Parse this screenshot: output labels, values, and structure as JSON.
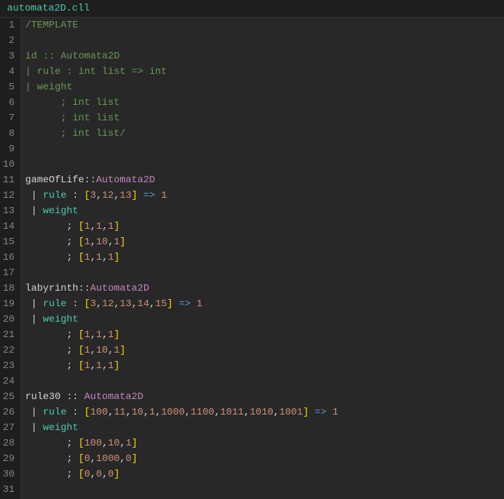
{
  "filename": "automata2D.cll",
  "code": {
    "lines": [
      {
        "n": 1,
        "tokens": [
          {
            "t": "/TEMPLATE",
            "c": "c-comment"
          }
        ]
      },
      {
        "n": 2,
        "tokens": []
      },
      {
        "n": 3,
        "tokens": [
          {
            "t": "id ",
            "c": "c-comment"
          },
          {
            "t": ":: ",
            "c": "c-comment"
          },
          {
            "t": "Automata2D",
            "c": "c-comment"
          }
        ]
      },
      {
        "n": 4,
        "tokens": [
          {
            "t": "| rule : int list => int",
            "c": "c-comment"
          }
        ]
      },
      {
        "n": 5,
        "tokens": [
          {
            "t": "| weight",
            "c": "c-comment"
          }
        ]
      },
      {
        "n": 6,
        "tokens": [
          {
            "t": "      ; int list",
            "c": "c-comment"
          }
        ]
      },
      {
        "n": 7,
        "tokens": [
          {
            "t": "      ; int list",
            "c": "c-comment"
          }
        ]
      },
      {
        "n": 8,
        "tokens": [
          {
            "t": "      ; int list/",
            "c": "c-comment"
          }
        ]
      },
      {
        "n": 9,
        "tokens": []
      },
      {
        "n": 10,
        "tokens": []
      },
      {
        "n": 11,
        "tokens": [
          {
            "t": "gameOfLife",
            "c": "c-ident"
          },
          {
            "t": "::",
            "c": "c-punct"
          },
          {
            "t": "Automata2D",
            "c": "c-type"
          }
        ]
      },
      {
        "n": 12,
        "tokens": [
          {
            "t": " ",
            "c": "c-white"
          },
          {
            "t": "|",
            "c": "c-punct"
          },
          {
            "t": " ",
            "c": "c-white"
          },
          {
            "t": "rule",
            "c": "c-key"
          },
          {
            "t": " : ",
            "c": "c-punct"
          },
          {
            "t": "[",
            "c": "c-brack"
          },
          {
            "t": "3",
            "c": "c-num"
          },
          {
            "t": ",",
            "c": "c-sep"
          },
          {
            "t": "12",
            "c": "c-num"
          },
          {
            "t": ",",
            "c": "c-sep"
          },
          {
            "t": "13",
            "c": "c-num"
          },
          {
            "t": "]",
            "c": "c-brack"
          },
          {
            "t": " ",
            "c": "c-white"
          },
          {
            "t": "=>",
            "c": "c-op"
          },
          {
            "t": " ",
            "c": "c-white"
          },
          {
            "t": "1",
            "c": "c-num"
          }
        ]
      },
      {
        "n": 13,
        "tokens": [
          {
            "t": " ",
            "c": "c-white"
          },
          {
            "t": "|",
            "c": "c-punct"
          },
          {
            "t": " ",
            "c": "c-white"
          },
          {
            "t": "weight",
            "c": "c-key"
          }
        ]
      },
      {
        "n": 14,
        "tokens": [
          {
            "t": "       ; ",
            "c": "c-punct"
          },
          {
            "t": "[",
            "c": "c-brack"
          },
          {
            "t": "1",
            "c": "c-num"
          },
          {
            "t": ",",
            "c": "c-sep"
          },
          {
            "t": "1",
            "c": "c-num"
          },
          {
            "t": ",",
            "c": "c-sep"
          },
          {
            "t": "1",
            "c": "c-num"
          },
          {
            "t": "]",
            "c": "c-brack"
          }
        ]
      },
      {
        "n": 15,
        "tokens": [
          {
            "t": "       ; ",
            "c": "c-punct"
          },
          {
            "t": "[",
            "c": "c-brack"
          },
          {
            "t": "1",
            "c": "c-num"
          },
          {
            "t": ",",
            "c": "c-sep"
          },
          {
            "t": "10",
            "c": "c-num"
          },
          {
            "t": ",",
            "c": "c-sep"
          },
          {
            "t": "1",
            "c": "c-num"
          },
          {
            "t": "]",
            "c": "c-brack"
          }
        ]
      },
      {
        "n": 16,
        "tokens": [
          {
            "t": "       ; ",
            "c": "c-punct"
          },
          {
            "t": "[",
            "c": "c-brack"
          },
          {
            "t": "1",
            "c": "c-num"
          },
          {
            "t": ",",
            "c": "c-sep"
          },
          {
            "t": "1",
            "c": "c-num"
          },
          {
            "t": ",",
            "c": "c-sep"
          },
          {
            "t": "1",
            "c": "c-num"
          },
          {
            "t": "]",
            "c": "c-brack"
          }
        ]
      },
      {
        "n": 17,
        "tokens": []
      },
      {
        "n": 18,
        "tokens": [
          {
            "t": "labyrinth",
            "c": "c-ident"
          },
          {
            "t": "::",
            "c": "c-punct"
          },
          {
            "t": "Automata2D",
            "c": "c-type"
          }
        ]
      },
      {
        "n": 19,
        "tokens": [
          {
            "t": " ",
            "c": "c-white"
          },
          {
            "t": "|",
            "c": "c-punct"
          },
          {
            "t": " ",
            "c": "c-white"
          },
          {
            "t": "rule",
            "c": "c-key"
          },
          {
            "t": " : ",
            "c": "c-punct"
          },
          {
            "t": "[",
            "c": "c-brack"
          },
          {
            "t": "3",
            "c": "c-num"
          },
          {
            "t": ",",
            "c": "c-sep"
          },
          {
            "t": "12",
            "c": "c-num"
          },
          {
            "t": ",",
            "c": "c-sep"
          },
          {
            "t": "13",
            "c": "c-num"
          },
          {
            "t": ",",
            "c": "c-sep"
          },
          {
            "t": "14",
            "c": "c-num"
          },
          {
            "t": ",",
            "c": "c-sep"
          },
          {
            "t": "15",
            "c": "c-num"
          },
          {
            "t": "]",
            "c": "c-brack"
          },
          {
            "t": " ",
            "c": "c-white"
          },
          {
            "t": "=>",
            "c": "c-op"
          },
          {
            "t": " ",
            "c": "c-white"
          },
          {
            "t": "1",
            "c": "c-num"
          }
        ]
      },
      {
        "n": 20,
        "tokens": [
          {
            "t": " ",
            "c": "c-white"
          },
          {
            "t": "|",
            "c": "c-punct"
          },
          {
            "t": " ",
            "c": "c-white"
          },
          {
            "t": "weight",
            "c": "c-key"
          }
        ]
      },
      {
        "n": 21,
        "tokens": [
          {
            "t": "       ; ",
            "c": "c-punct"
          },
          {
            "t": "[",
            "c": "c-brack"
          },
          {
            "t": "1",
            "c": "c-num"
          },
          {
            "t": ",",
            "c": "c-sep"
          },
          {
            "t": "1",
            "c": "c-num"
          },
          {
            "t": ",",
            "c": "c-sep"
          },
          {
            "t": "1",
            "c": "c-num"
          },
          {
            "t": "]",
            "c": "c-brack"
          }
        ]
      },
      {
        "n": 22,
        "tokens": [
          {
            "t": "       ; ",
            "c": "c-punct"
          },
          {
            "t": "[",
            "c": "c-brack"
          },
          {
            "t": "1",
            "c": "c-num"
          },
          {
            "t": ",",
            "c": "c-sep"
          },
          {
            "t": "10",
            "c": "c-num"
          },
          {
            "t": ",",
            "c": "c-sep"
          },
          {
            "t": "1",
            "c": "c-num"
          },
          {
            "t": "]",
            "c": "c-brack"
          }
        ]
      },
      {
        "n": 23,
        "tokens": [
          {
            "t": "       ; ",
            "c": "c-punct"
          },
          {
            "t": "[",
            "c": "c-brack"
          },
          {
            "t": "1",
            "c": "c-num"
          },
          {
            "t": ",",
            "c": "c-sep"
          },
          {
            "t": "1",
            "c": "c-num"
          },
          {
            "t": ",",
            "c": "c-sep"
          },
          {
            "t": "1",
            "c": "c-num"
          },
          {
            "t": "]",
            "c": "c-brack"
          }
        ]
      },
      {
        "n": 24,
        "tokens": []
      },
      {
        "n": 25,
        "tokens": [
          {
            "t": "rule30",
            "c": "c-ident"
          },
          {
            "t": " :: ",
            "c": "c-punct"
          },
          {
            "t": "Automata2D",
            "c": "c-type"
          }
        ]
      },
      {
        "n": 26,
        "tokens": [
          {
            "t": " ",
            "c": "c-white"
          },
          {
            "t": "|",
            "c": "c-punct"
          },
          {
            "t": " ",
            "c": "c-white"
          },
          {
            "t": "rule",
            "c": "c-key"
          },
          {
            "t": " : ",
            "c": "c-punct"
          },
          {
            "t": "[",
            "c": "c-brack"
          },
          {
            "t": "100",
            "c": "c-num"
          },
          {
            "t": ",",
            "c": "c-sep"
          },
          {
            "t": "11",
            "c": "c-num"
          },
          {
            "t": ",",
            "c": "c-sep"
          },
          {
            "t": "10",
            "c": "c-num"
          },
          {
            "t": ",",
            "c": "c-sep"
          },
          {
            "t": "1",
            "c": "c-num"
          },
          {
            "t": ",",
            "c": "c-sep"
          },
          {
            "t": "1000",
            "c": "c-num"
          },
          {
            "t": ",",
            "c": "c-sep"
          },
          {
            "t": "1100",
            "c": "c-num"
          },
          {
            "t": ",",
            "c": "c-sep"
          },
          {
            "t": "1011",
            "c": "c-num"
          },
          {
            "t": ",",
            "c": "c-sep"
          },
          {
            "t": "1010",
            "c": "c-num"
          },
          {
            "t": ",",
            "c": "c-sep"
          },
          {
            "t": "1001",
            "c": "c-num"
          },
          {
            "t": "]",
            "c": "c-brack"
          },
          {
            "t": " ",
            "c": "c-white"
          },
          {
            "t": "=>",
            "c": "c-op"
          },
          {
            "t": " ",
            "c": "c-white"
          },
          {
            "t": "1",
            "c": "c-num"
          }
        ]
      },
      {
        "n": 27,
        "tokens": [
          {
            "t": " ",
            "c": "c-white"
          },
          {
            "t": "|",
            "c": "c-punct"
          },
          {
            "t": " ",
            "c": "c-white"
          },
          {
            "t": "weight",
            "c": "c-key"
          }
        ]
      },
      {
        "n": 28,
        "tokens": [
          {
            "t": "       ; ",
            "c": "c-punct"
          },
          {
            "t": "[",
            "c": "c-brack"
          },
          {
            "t": "100",
            "c": "c-num"
          },
          {
            "t": ",",
            "c": "c-sep"
          },
          {
            "t": "10",
            "c": "c-num"
          },
          {
            "t": ",",
            "c": "c-sep"
          },
          {
            "t": "1",
            "c": "c-num"
          },
          {
            "t": "]",
            "c": "c-brack"
          }
        ]
      },
      {
        "n": 29,
        "tokens": [
          {
            "t": "       ; ",
            "c": "c-punct"
          },
          {
            "t": "[",
            "c": "c-brack"
          },
          {
            "t": "0",
            "c": "c-num"
          },
          {
            "t": ",",
            "c": "c-sep"
          },
          {
            "t": "1000",
            "c": "c-num"
          },
          {
            "t": ",",
            "c": "c-sep"
          },
          {
            "t": "0",
            "c": "c-num"
          },
          {
            "t": "]",
            "c": "c-brack"
          }
        ]
      },
      {
        "n": 30,
        "tokens": [
          {
            "t": "       ; ",
            "c": "c-punct"
          },
          {
            "t": "[",
            "c": "c-brack"
          },
          {
            "t": "0",
            "c": "c-num"
          },
          {
            "t": ",",
            "c": "c-sep"
          },
          {
            "t": "0",
            "c": "c-num"
          },
          {
            "t": ",",
            "c": "c-sep"
          },
          {
            "t": "0",
            "c": "c-num"
          },
          {
            "t": "]",
            "c": "c-brack"
          }
        ]
      },
      {
        "n": 31,
        "tokens": []
      }
    ]
  }
}
